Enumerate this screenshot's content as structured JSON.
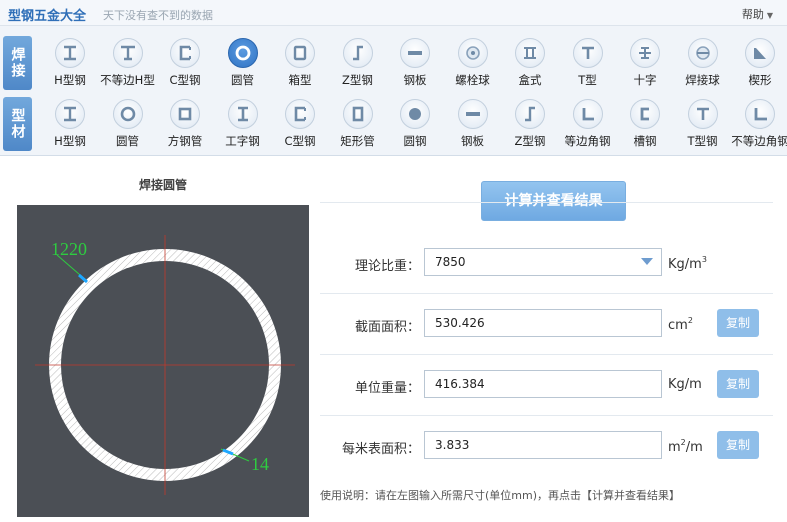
{
  "header": {
    "title": "型钢五金大全",
    "slogan": "天下没有查不到的数据",
    "help": "帮助"
  },
  "rows": [
    {
      "tag": "焊接",
      "items": [
        {
          "label": "H型钢",
          "icon": "h-beam-icon"
        },
        {
          "label": "不等边H型",
          "icon": "unequal-h-beam-icon"
        },
        {
          "label": "C型钢",
          "icon": "c-channel-icon"
        },
        {
          "label": "圆管",
          "icon": "round-tube-icon",
          "active": true
        },
        {
          "label": "箱型",
          "icon": "box-section-icon"
        },
        {
          "label": "Z型钢",
          "icon": "z-section-icon"
        },
        {
          "label": "钢板",
          "icon": "steel-plate-icon"
        },
        {
          "label": "螺栓球",
          "icon": "bolt-ball-icon"
        },
        {
          "label": "盒式",
          "icon": "box-type-icon"
        },
        {
          "label": "T型",
          "icon": "t-section-icon"
        },
        {
          "label": "十字",
          "icon": "cross-section-icon"
        },
        {
          "label": "焊接球",
          "icon": "welded-ball-icon"
        },
        {
          "label": "楔形",
          "icon": "wedge-icon"
        }
      ]
    },
    {
      "tag": "型材",
      "items": [
        {
          "label": "H型钢",
          "icon": "h-beam-icon"
        },
        {
          "label": "圆管",
          "icon": "round-tube-icon"
        },
        {
          "label": "方钢管",
          "icon": "square-tube-icon"
        },
        {
          "label": "工字钢",
          "icon": "i-beam-icon"
        },
        {
          "label": "C型钢",
          "icon": "c-channel-icon"
        },
        {
          "label": "矩形管",
          "icon": "rect-tube-icon"
        },
        {
          "label": "圆钢",
          "icon": "round-bar-icon"
        },
        {
          "label": "钢板",
          "icon": "steel-plate-icon"
        },
        {
          "label": "Z型钢",
          "icon": "z-section-icon"
        },
        {
          "label": "等边角钢",
          "icon": "equal-angle-icon"
        },
        {
          "label": "槽钢",
          "icon": "channel-icon"
        },
        {
          "label": "T型钢",
          "icon": "t-section-icon"
        },
        {
          "label": "不等边角钢",
          "icon": "unequal-angle-icon"
        }
      ]
    }
  ],
  "diagram": {
    "title": "焊接圆管",
    "diameter": "1220",
    "thickness": "14"
  },
  "form": {
    "calc_button": "计算并查看结果",
    "density_label": "理论比重：",
    "density_value": "7850",
    "density_unit": "Kg/m",
    "density_unit_exp": "3",
    "area_label": "截面面积：",
    "area_value": "530.426",
    "area_unit": "cm",
    "area_unit_exp": "2",
    "weight_label": "单位重量：",
    "weight_value": "416.384",
    "weight_unit": "Kg/m",
    "surface_label": "每米表面积：",
    "surface_value": "3.833",
    "surface_unit_pre": "m",
    "surface_unit_exp": "2",
    "surface_unit_post": "/m",
    "copy_label": "复制",
    "usage": "使用说明：请在左图输入所需尺寸(单位mm)，再点击【计算并查看结果】"
  },
  "colors": {
    "accent": "#4f88c8",
    "button": "#6fa9e2",
    "diagram_bg": "#4b4f55",
    "dimension_text": "#2ecc40"
  }
}
